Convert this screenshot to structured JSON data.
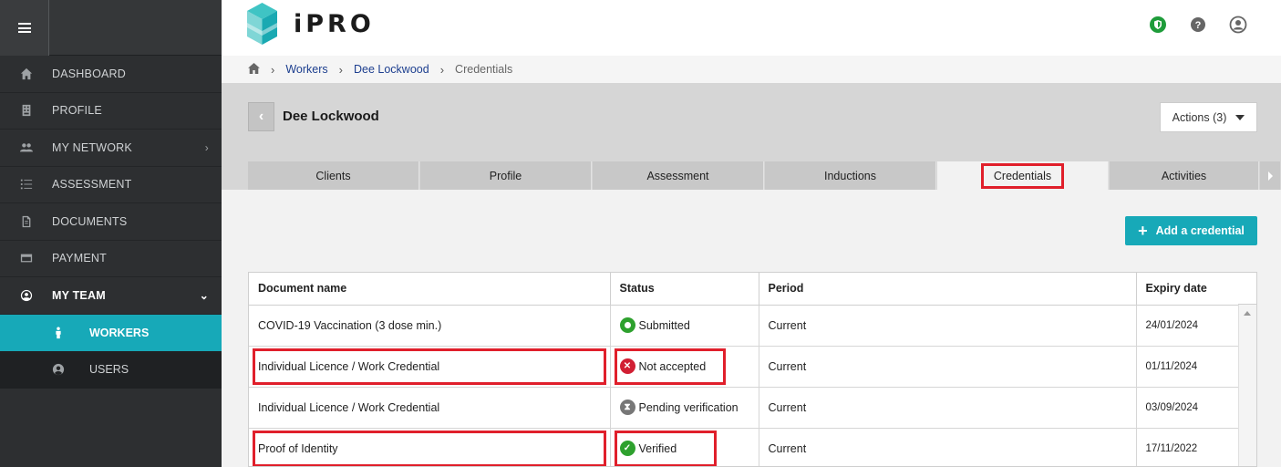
{
  "app": {
    "logo_text": "iPRO",
    "colors": {
      "accent": "#17a9b8",
      "sidebar": "#2d2f31",
      "highlight": "#e01f2b"
    }
  },
  "sidebar": {
    "items": [
      {
        "label": "DASHBOARD",
        "icon": "home-icon"
      },
      {
        "label": "PROFILE",
        "icon": "building-icon"
      },
      {
        "label": "MY NETWORK",
        "icon": "users-icon",
        "chevron": "›"
      },
      {
        "label": "ASSESSMENT",
        "icon": "list-icon"
      },
      {
        "label": "DOCUMENTS",
        "icon": "document-icon"
      },
      {
        "label": "PAYMENT",
        "icon": "credit-card-icon"
      },
      {
        "label": "MY TEAM",
        "icon": "user-circle-icon",
        "chevron": "⌄"
      }
    ],
    "subitems": [
      {
        "label": "WORKERS",
        "icon": "person-icon"
      },
      {
        "label": "USERS",
        "icon": "user-circle-icon"
      }
    ]
  },
  "header": {
    "icons": [
      "shield-icon",
      "help-icon",
      "account-icon"
    ]
  },
  "breadcrumb": {
    "items": [
      "Workers",
      "Dee Lockwood"
    ],
    "current": "Credentials"
  },
  "page": {
    "name": "Dee Lockwood",
    "actions_label": "Actions (3)",
    "add_button_label": "Add a credential"
  },
  "tabs": [
    "Clients",
    "Profile",
    "Assessment",
    "Inductions",
    "Credentials",
    "Activities"
  ],
  "table": {
    "columns": [
      "Document name",
      "Status",
      "Period",
      "Expiry date"
    ],
    "rows": [
      {
        "name": "COVID-19 Vaccination (3 dose min.)",
        "status": "Submitted",
        "status_color": "#2ea12e",
        "period": "Current",
        "expiry": "24/01/2024"
      },
      {
        "name": "Individual Licence / Work Credential",
        "status": "Not accepted",
        "status_color": "#d11f33",
        "period": "Current",
        "expiry": "01/11/2024"
      },
      {
        "name": "Individual Licence / Work Credential",
        "status": "Pending verification",
        "status_color": "#777777",
        "period": "Current",
        "expiry": "03/09/2024"
      },
      {
        "name": "Proof of Identity",
        "status": "Verified",
        "status_color": "#2ea12e",
        "period": "Current",
        "expiry": "17/11/2022"
      }
    ]
  }
}
